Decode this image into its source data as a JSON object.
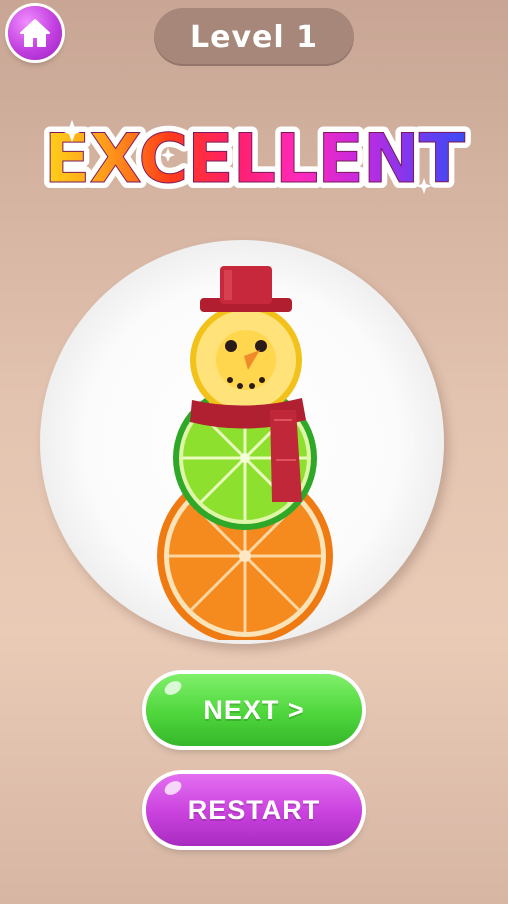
{
  "header": {
    "home_icon": "house-icon",
    "level_label": "Level 1"
  },
  "result": {
    "headline": "EXCELLENT"
  },
  "dish": {
    "name": "fruit snowman"
  },
  "buttons": {
    "next_label": "NEXT >",
    "restart_label": "RESTART"
  },
  "colors": {
    "home": "#c23fe0",
    "level_pill": "#a7877a",
    "next": "#4fd63c",
    "restart": "#c941dd"
  }
}
